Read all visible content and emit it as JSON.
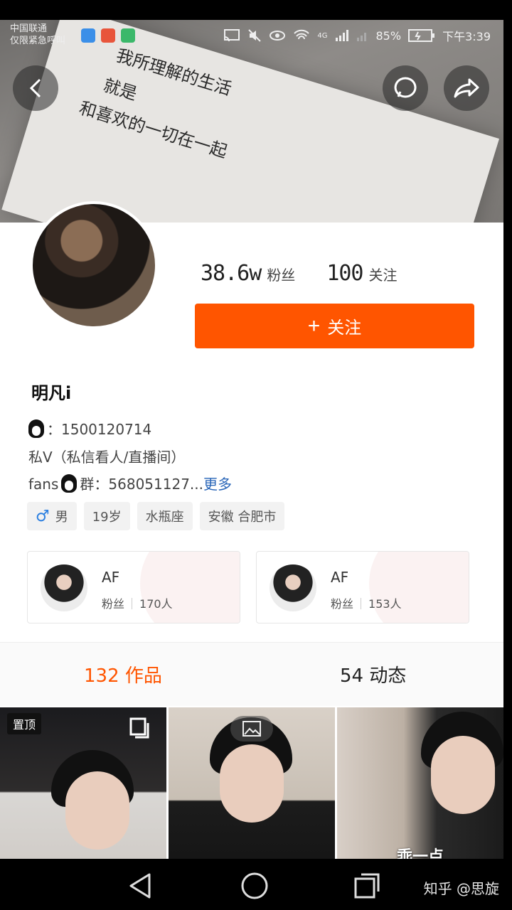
{
  "status_bar": {
    "carrier_line1": "中国联通",
    "carrier_line2": "仅限紧急呼叫",
    "network": "4G",
    "battery": "85%",
    "time": "下午3:39"
  },
  "cover": {
    "text_line1": "我所理解的生活",
    "text_line2": "就是",
    "text_line3": "和喜欢的一切在一起"
  },
  "profile": {
    "fans_count": "38.6w",
    "fans_label": "粉丝",
    "following_count": "100",
    "following_label": "关注",
    "follow_button": "关注",
    "name": "明凡i",
    "qq_line": "：1500120714",
    "dm_line": "私V（私信看人/直播间）",
    "fans_group_prefix": "fans",
    "fans_group": "群：568051127...",
    "more_link": "更多",
    "tags": {
      "gender": "男",
      "age": "19岁",
      "zodiac": "水瓶座",
      "location": "安徽 合肥市"
    }
  },
  "fan_cards": [
    {
      "name": "AF",
      "fans_label": "粉丝",
      "count": "170人"
    },
    {
      "name": "AF",
      "fans_label": "粉丝",
      "count": "153人"
    }
  ],
  "tabs": {
    "works_count": "132",
    "works_label": "作品",
    "dynamics_count": "54",
    "dynamics_label": "动态"
  },
  "grid": {
    "pinned_badge": "置顶",
    "caption_3": "乖一点"
  },
  "watermark": "知乎 @思旋",
  "colors": {
    "accent": "#ff5500",
    "link": "#2a66b8",
    "male": "#2b7fe0"
  }
}
